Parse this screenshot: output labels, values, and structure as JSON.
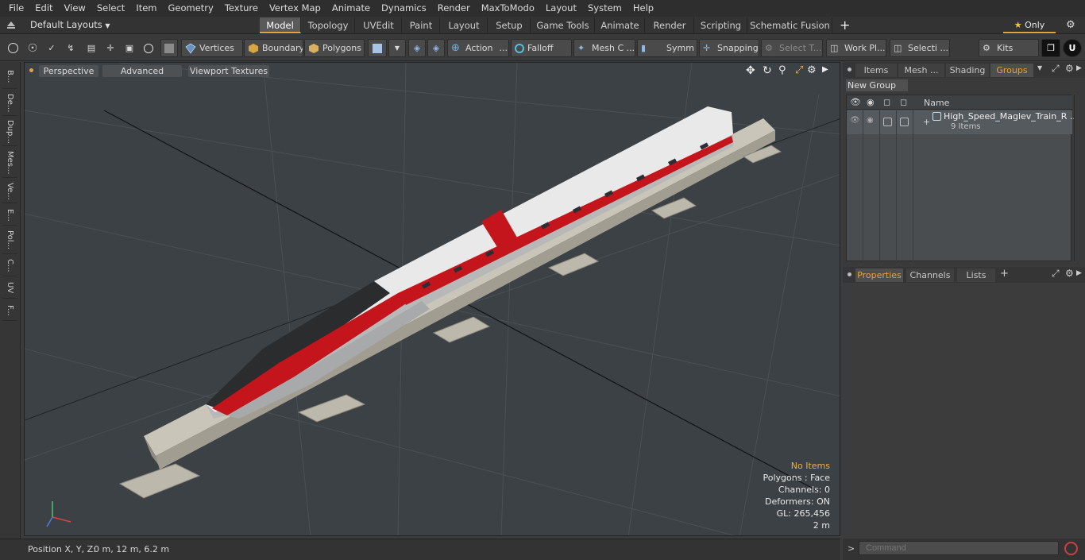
{
  "menu": [
    "File",
    "Edit",
    "View",
    "Select",
    "Item",
    "Geometry",
    "Texture",
    "Vertex Map",
    "Animate",
    "Dynamics",
    "Render",
    "MaxToModo",
    "Layout",
    "System",
    "Help"
  ],
  "layouts": {
    "selector": "Default Layouts",
    "tabs": [
      "Model",
      "Topology",
      "UVEdit",
      "Paint",
      "Layout",
      "Setup",
      "Game Tools",
      "Animate",
      "Render",
      "Scripting",
      "Schematic Fusion"
    ],
    "active": "Model",
    "only_label": "Only"
  },
  "toolbar": {
    "vertices": "Vertices",
    "boundary": "Boundary",
    "polygons": "Polygons",
    "action": "Action",
    "falloff": "Falloff",
    "mesh": "Mesh C ...",
    "symm": "Symm ...",
    "snapping": "Snapping",
    "select_t": "Select T...",
    "work_pl": "Work Pl...",
    "selecti": "Selecti ...",
    "kits": "Kits"
  },
  "left_tabs": [
    "B...",
    "De...",
    "Dup...",
    "Mes...",
    "Ve...",
    "E...",
    "Pol...",
    "C...",
    "UV",
    "F..."
  ],
  "viewport": {
    "perspective": "Perspective",
    "advanced": "Advanced",
    "textures": "Viewport Textures",
    "stats": {
      "no_items": "No Items",
      "polygons": "Polygons : Face",
      "channels": "Channels: 0",
      "deformers": "Deformers: ON",
      "gl": "GL: 265,456",
      "scale": "2 m"
    }
  },
  "status": {
    "position_label": "Position X, Y, Z:",
    "position_value": "0 m, 12 m, 6.2 m"
  },
  "right_panel": {
    "tabs": [
      "Items",
      "Mesh ...",
      "Shading",
      "Groups"
    ],
    "active_tab": "Groups",
    "new_group": "New Group",
    "name_header": "Name",
    "group_name": "High_Speed_Maglev_Train_R ...",
    "group_count": "9 Items",
    "prop_tabs": [
      "Properties",
      "Channels",
      "Lists"
    ],
    "prop_active": "Properties"
  },
  "command": {
    "placeholder": "Command"
  },
  "colors": {
    "accent": "#e7a23c",
    "train_red": "#c4141c",
    "train_white": "#e9e9e9"
  }
}
